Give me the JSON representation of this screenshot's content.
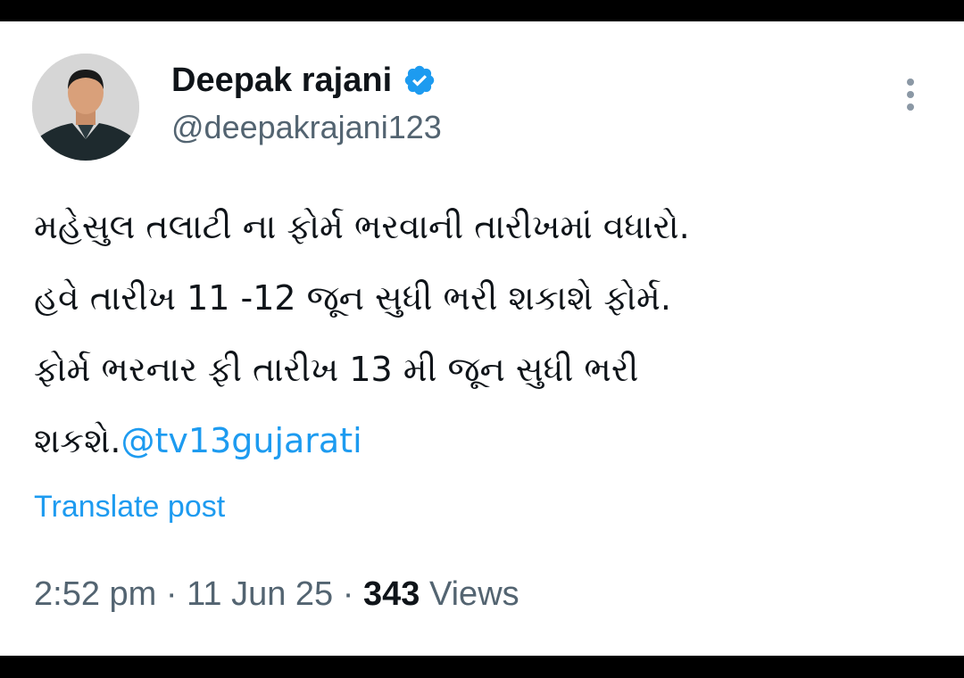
{
  "post": {
    "author": {
      "display_name": "Deepak rajani",
      "handle": "@deepakrajani123",
      "verified_icon": "verified-badge-icon",
      "avatar_icon": "profile-photo"
    },
    "menu_icon": "more-options-icon",
    "text_lines": [
      "મહેસુલ તલાટી ના ફોર્મ ભરવાની તારીખમાં વધારો.",
      "હવે તારીખ 11 -12 જૂન સુધી ભરી શકાશે ફોર્મ.",
      "ફોર્મ ભરનાર ફી તારીખ 13 મી જૂન સુધી ભરી",
      "શકશે."
    ],
    "mention": "@tv13gujarati",
    "translate_label": "Translate post",
    "time": "2:52 pm",
    "separator": "·",
    "date": "11 Jun 25",
    "views_count": "343",
    "views_label": "Views"
  },
  "colors": {
    "accent": "#1d9bf0",
    "text_primary": "#0f1419",
    "text_secondary": "#536471",
    "background": "#ffffff",
    "frame": "#000000"
  }
}
